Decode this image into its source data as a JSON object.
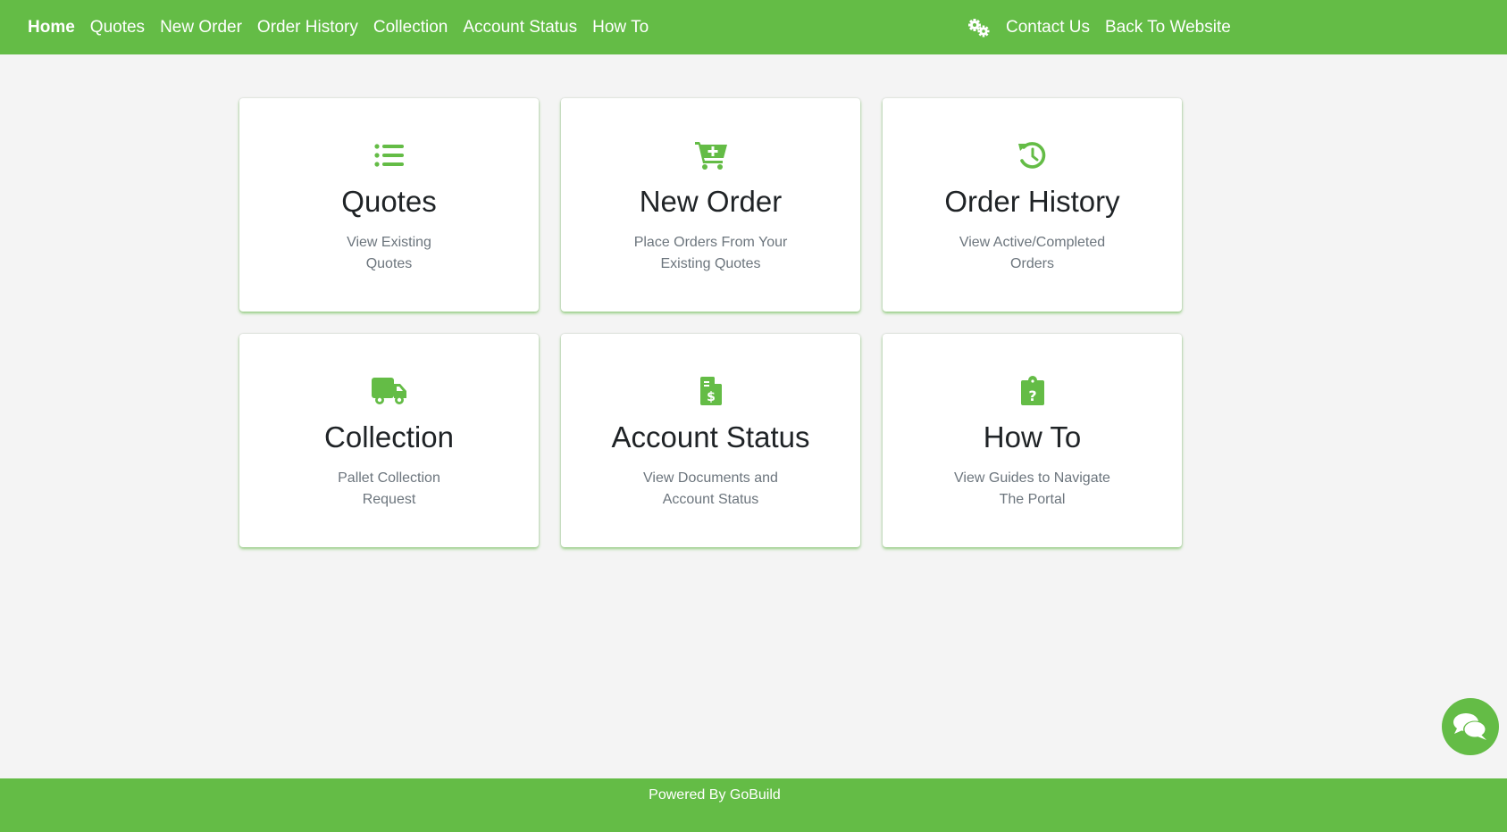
{
  "colors": {
    "brand_green": "#64bc46",
    "title_text": "#1f2326",
    "muted_text": "#6c757d",
    "background": "#f4f4f4"
  },
  "nav": {
    "left": [
      {
        "label": "Home",
        "active": true
      },
      {
        "label": "Quotes"
      },
      {
        "label": "New Order"
      },
      {
        "label": "Order History"
      },
      {
        "label": "Collection"
      },
      {
        "label": "Account Status"
      },
      {
        "label": "How To"
      }
    ],
    "settings_icon": "gears-icon",
    "right": [
      {
        "label": "Contact Us"
      },
      {
        "label": "Back To Website"
      }
    ]
  },
  "cards": [
    {
      "icon": "list-icon",
      "title": "Quotes",
      "desc_line1": "View Existing",
      "desc_line2": "Quotes"
    },
    {
      "icon": "cart-plus-icon",
      "title": "New Order",
      "desc_line1": "Place Orders From Your",
      "desc_line2": "Existing Quotes"
    },
    {
      "icon": "history-icon",
      "title": "Order History",
      "desc_line1": "View Active/Completed",
      "desc_line2": "Orders"
    },
    {
      "icon": "truck-icon",
      "title": "Collection",
      "desc_line1": "Pallet Collection",
      "desc_line2": "Request"
    },
    {
      "icon": "file-invoice-dollar-icon",
      "title": "Account Status",
      "desc_line1": "View Documents and",
      "desc_line2": "Account Status"
    },
    {
      "icon": "clipboard-question-icon",
      "title": "How To",
      "desc_line1": "View Guides to Navigate",
      "desc_line2": "The Portal"
    }
  ],
  "chat": {
    "icon": "comments-icon"
  },
  "footer": {
    "text": "Powered By GoBuild"
  }
}
